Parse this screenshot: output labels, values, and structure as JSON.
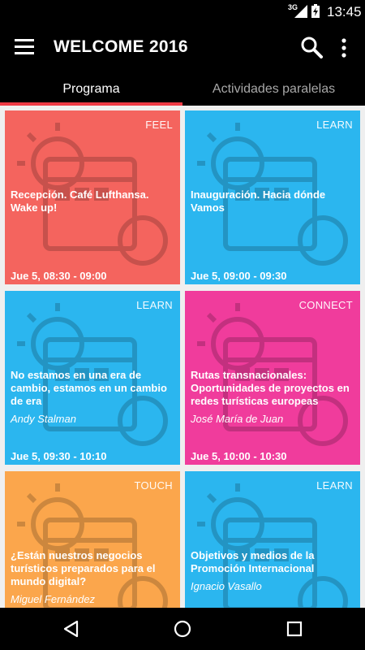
{
  "status_bar": {
    "network": "3G",
    "time": "13:45"
  },
  "app_bar": {
    "title": "WELCOME 2016",
    "icons": [
      "menu-icon",
      "search-icon",
      "more-vert-icon"
    ]
  },
  "tabs": [
    {
      "label": "Programa",
      "active": true
    },
    {
      "label": "Actividades paralelas",
      "active": false
    }
  ],
  "colors": {
    "feel": "#f4645e",
    "learn": "#2bb6ef",
    "connect": "#f03c9c",
    "touch": "#fba64c",
    "tab_indicator": "#ee3a44"
  },
  "cards": [
    {
      "tag": "FEEL",
      "title": "Recepción. Café Lufthansa. Wake up!",
      "speaker": "",
      "time": "Jue 5, 08:30 - 09:00"
    },
    {
      "tag": "LEARN",
      "title": "Inauguración. Hacia dónde Vamos",
      "speaker": "",
      "time": "Jue 5, 09:00 - 09:30"
    },
    {
      "tag": "LEARN",
      "title": "No estamos en una era de cambio, estamos en un cambio de era",
      "speaker": "Andy Stalman",
      "time": "Jue 5, 09:30 - 10:10"
    },
    {
      "tag": "CONNECT",
      "title": "Rutas transnacionales: Oportunidades de proyectos en redes turísticas europeas",
      "speaker": "José María de Juan",
      "time": "Jue 5, 10:00 - 10:30"
    },
    {
      "tag": "TOUCH",
      "title": "¿Están nuestros negocios turísticos preparados para el mundo digital?",
      "speaker": "Miguel Fernández",
      "time": ""
    },
    {
      "tag": "LEARN",
      "title": "Objetivos y medios de la Promoción Internacional",
      "speaker": "Ignacio Vasallo",
      "time": ""
    }
  ],
  "nav_bar": {
    "icons": [
      "back-icon",
      "home-icon",
      "recent-apps-icon"
    ]
  }
}
